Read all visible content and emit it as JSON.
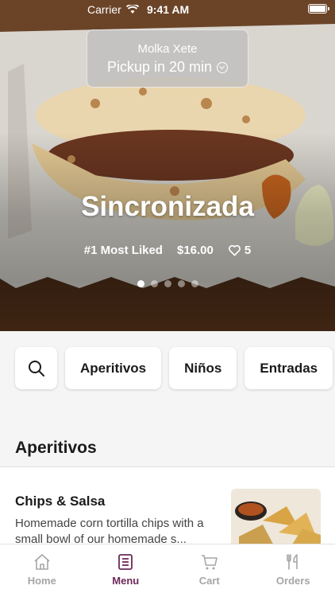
{
  "status_bar": {
    "carrier": "Carrier",
    "time": "9:41 AM"
  },
  "pickup": {
    "store": "Molka Xete",
    "eta": "Pickup in 20 min"
  },
  "featured": {
    "name": "Sincronizada",
    "rank": "#1 Most Liked",
    "price": "$16.00",
    "likes": "5",
    "slide_count": 5,
    "active_slide": 1
  },
  "categories": [
    "Aperitivos",
    "Niños",
    "Entradas"
  ],
  "section": {
    "title": "Aperitivos"
  },
  "items": [
    {
      "name": "Chips & Salsa",
      "description": "Homemade corn tortilla chips with a small bowl of our homemade s..."
    }
  ],
  "tabs": [
    {
      "label": "Home",
      "icon": "home-icon"
    },
    {
      "label": "Menu",
      "icon": "menu-icon"
    },
    {
      "label": "Cart",
      "icon": "cart-icon"
    },
    {
      "label": "Orders",
      "icon": "orders-icon"
    }
  ],
  "active_tab": "Menu",
  "colors": {
    "accent": "#6b2a57",
    "inactive": "#a6a6a6"
  }
}
